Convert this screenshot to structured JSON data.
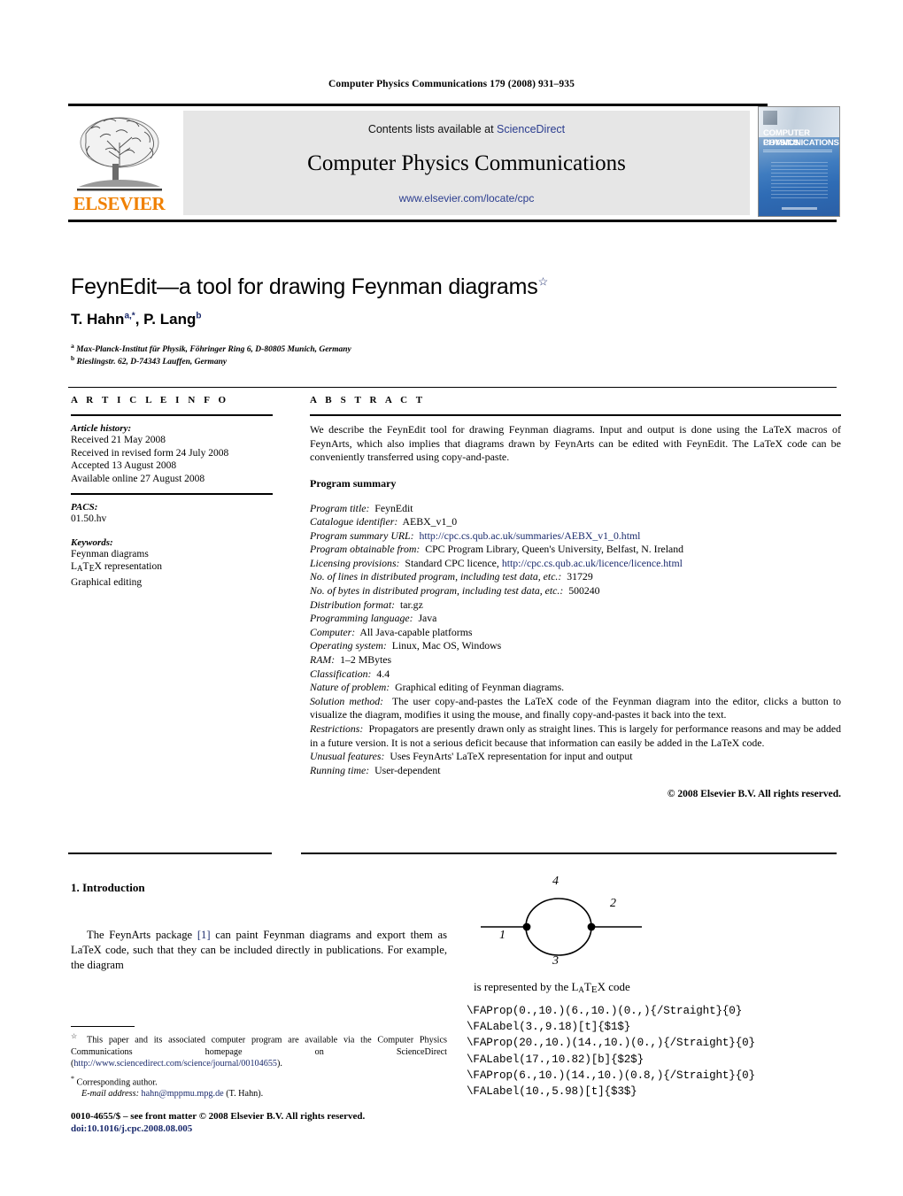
{
  "running_head": "Computer Physics Communications 179 (2008) 931–935",
  "masthead": {
    "contents_prefix": "Contents lists available at ",
    "sciencedirect": "ScienceDirect",
    "journal_title": "Computer Physics Communications",
    "journal_url": "www.elsevier.com/locate/cpc",
    "publisher_wordmark": "ELSEVIER",
    "publisher_color": "#f08000",
    "link_color": "#2b3d8f",
    "cover": {
      "line1": "COMPUTER PHYSICS",
      "line2": "COMMUNICATIONS"
    }
  },
  "article": {
    "title": "FeynEdit—a tool for drawing Feynman diagrams",
    "title_footnote_marker": "☆",
    "authors": "T. Hahn",
    "author1_sup": "a,*",
    "author2": ", P. Lang",
    "author2_sup": "b",
    "affiliations": [
      {
        "sup": "a",
        "text": "Max-Planck-Institut für Physik, Föhringer Ring 6, D-80805 Munich, Germany"
      },
      {
        "sup": "b",
        "text": "Rieslingstr. 62, D-74343 Lauffen, Germany"
      }
    ]
  },
  "info": {
    "label": "A R T I C L E   I N F O",
    "history_head": "Article history:",
    "history": [
      "Received 21 May 2008",
      "Received in revised form 24 July 2008",
      "Accepted 13 August 2008",
      "Available online 27 August 2008"
    ],
    "pacs_head": "PACS:",
    "pacs": "01.50.hv",
    "keywords_head": "Keywords:",
    "keywords": [
      "Feynman diagrams",
      "LaTeX representation",
      "Graphical editing"
    ]
  },
  "abstract": {
    "label": "A B S T R A C T",
    "text": "We describe the FeynEdit tool for drawing Feynman diagrams. Input and output is done using the LaTeX macros of FeynArts, which also implies that diagrams drawn by FeynArts can be edited with FeynEdit. The LaTeX code can be conveniently transferred using copy-and-paste.",
    "program_summary_head": "Program summary",
    "fields": [
      {
        "key": "Program title:",
        "value": "FeynEdit"
      },
      {
        "key": "Catalogue identifier:",
        "value": "AEBX_v1_0"
      },
      {
        "key": "Program summary URL:",
        "value": "http://cpc.cs.qub.ac.uk/summaries/AEBX_v1_0.html",
        "link": true
      },
      {
        "key": "Program obtainable from:",
        "value": "CPC Program Library, Queen's University, Belfast, N. Ireland"
      },
      {
        "key": "Licensing provisions:",
        "value": "Standard CPC licence, ",
        "value_link": "http://cpc.cs.qub.ac.uk/licence/licence.html"
      },
      {
        "key": "No. of lines in distributed program, including test data, etc.:",
        "value": "31729"
      },
      {
        "key": "No. of bytes in distributed program, including test data, etc.:",
        "value": "500240"
      },
      {
        "key": "Distribution format:",
        "value": "tar.gz"
      },
      {
        "key": "Programming language:",
        "value": "Java"
      },
      {
        "key": "Computer:",
        "value": "All Java-capable platforms"
      },
      {
        "key": "Operating system:",
        "value": "Linux, Mac OS, Windows"
      },
      {
        "key": "RAM:",
        "value": "1–2 MBytes"
      },
      {
        "key": "Classification:",
        "value": "4.4"
      },
      {
        "key": "Nature of problem:",
        "value": "Graphical editing of Feynman diagrams."
      },
      {
        "key": "Solution method:",
        "value": "The user copy-and-pastes the LaTeX code of the Feynman diagram into the editor, clicks a button to visualize the diagram, modifies it using the mouse, and finally copy-and-pastes it back into the text."
      },
      {
        "key": "Restrictions:",
        "value": "Propagators are presently drawn only as straight lines. This is largely for performance reasons and may be added in a future version. It is not a serious deficit because that information can easily be added in the LaTeX code."
      },
      {
        "key": "Unusual features:",
        "value": "Uses FeynArts' LaTeX representation for input and output"
      },
      {
        "key": "Running time:",
        "value": "User-dependent"
      }
    ],
    "copyright": "© 2008 Elsevier B.V. All rights reserved."
  },
  "body": {
    "section_heading": "1. Introduction",
    "intro_part1": "The FeynArts package ",
    "intro_ref": "[1]",
    "intro_part2": " can paint Feynman diagrams and export them as LaTeX code, such that they can be included directly in publications. For example, the diagram",
    "represented_line": "is represented by the LaTeX code",
    "code": "\\FAProp(0.,10.)(6.,10.)(0.,){/Straight}{0}\n\\FALabel(3.,9.18)[t]{$1$}\n\\FAProp(20.,10.)(14.,10.)(0.,){/Straight}{0}\n\\FALabel(17.,10.82)[b]{$2$}\n\\FAProp(6.,10.)(14.,10.)(0.8,){/Straight}{0}\n\\FALabel(10.,5.98)[t]{$3$}"
  },
  "figure": {
    "labels": [
      "4",
      "2",
      "1",
      "3"
    ]
  },
  "footnotes": {
    "star_marker": "☆",
    "star_text_1": "This paper and its associated computer program are available via the Computer Physics Communications homepage on ScienceDirect (",
    "star_link": "http://www.sciencedirect.com/science/journal/00104655",
    "star_text_2": ").",
    "corr_marker": "*",
    "corr_text": "Corresponding author.",
    "email_label": "E-mail address:",
    "email": "hahn@mppmu.mpg.de",
    "email_suffix": " (T. Hahn)."
  },
  "bottom": {
    "issn_line": "0010-4655/$ – see front matter © 2008 Elsevier B.V. All rights reserved.",
    "doi": "doi:10.1016/j.cpc.2008.08.005"
  }
}
